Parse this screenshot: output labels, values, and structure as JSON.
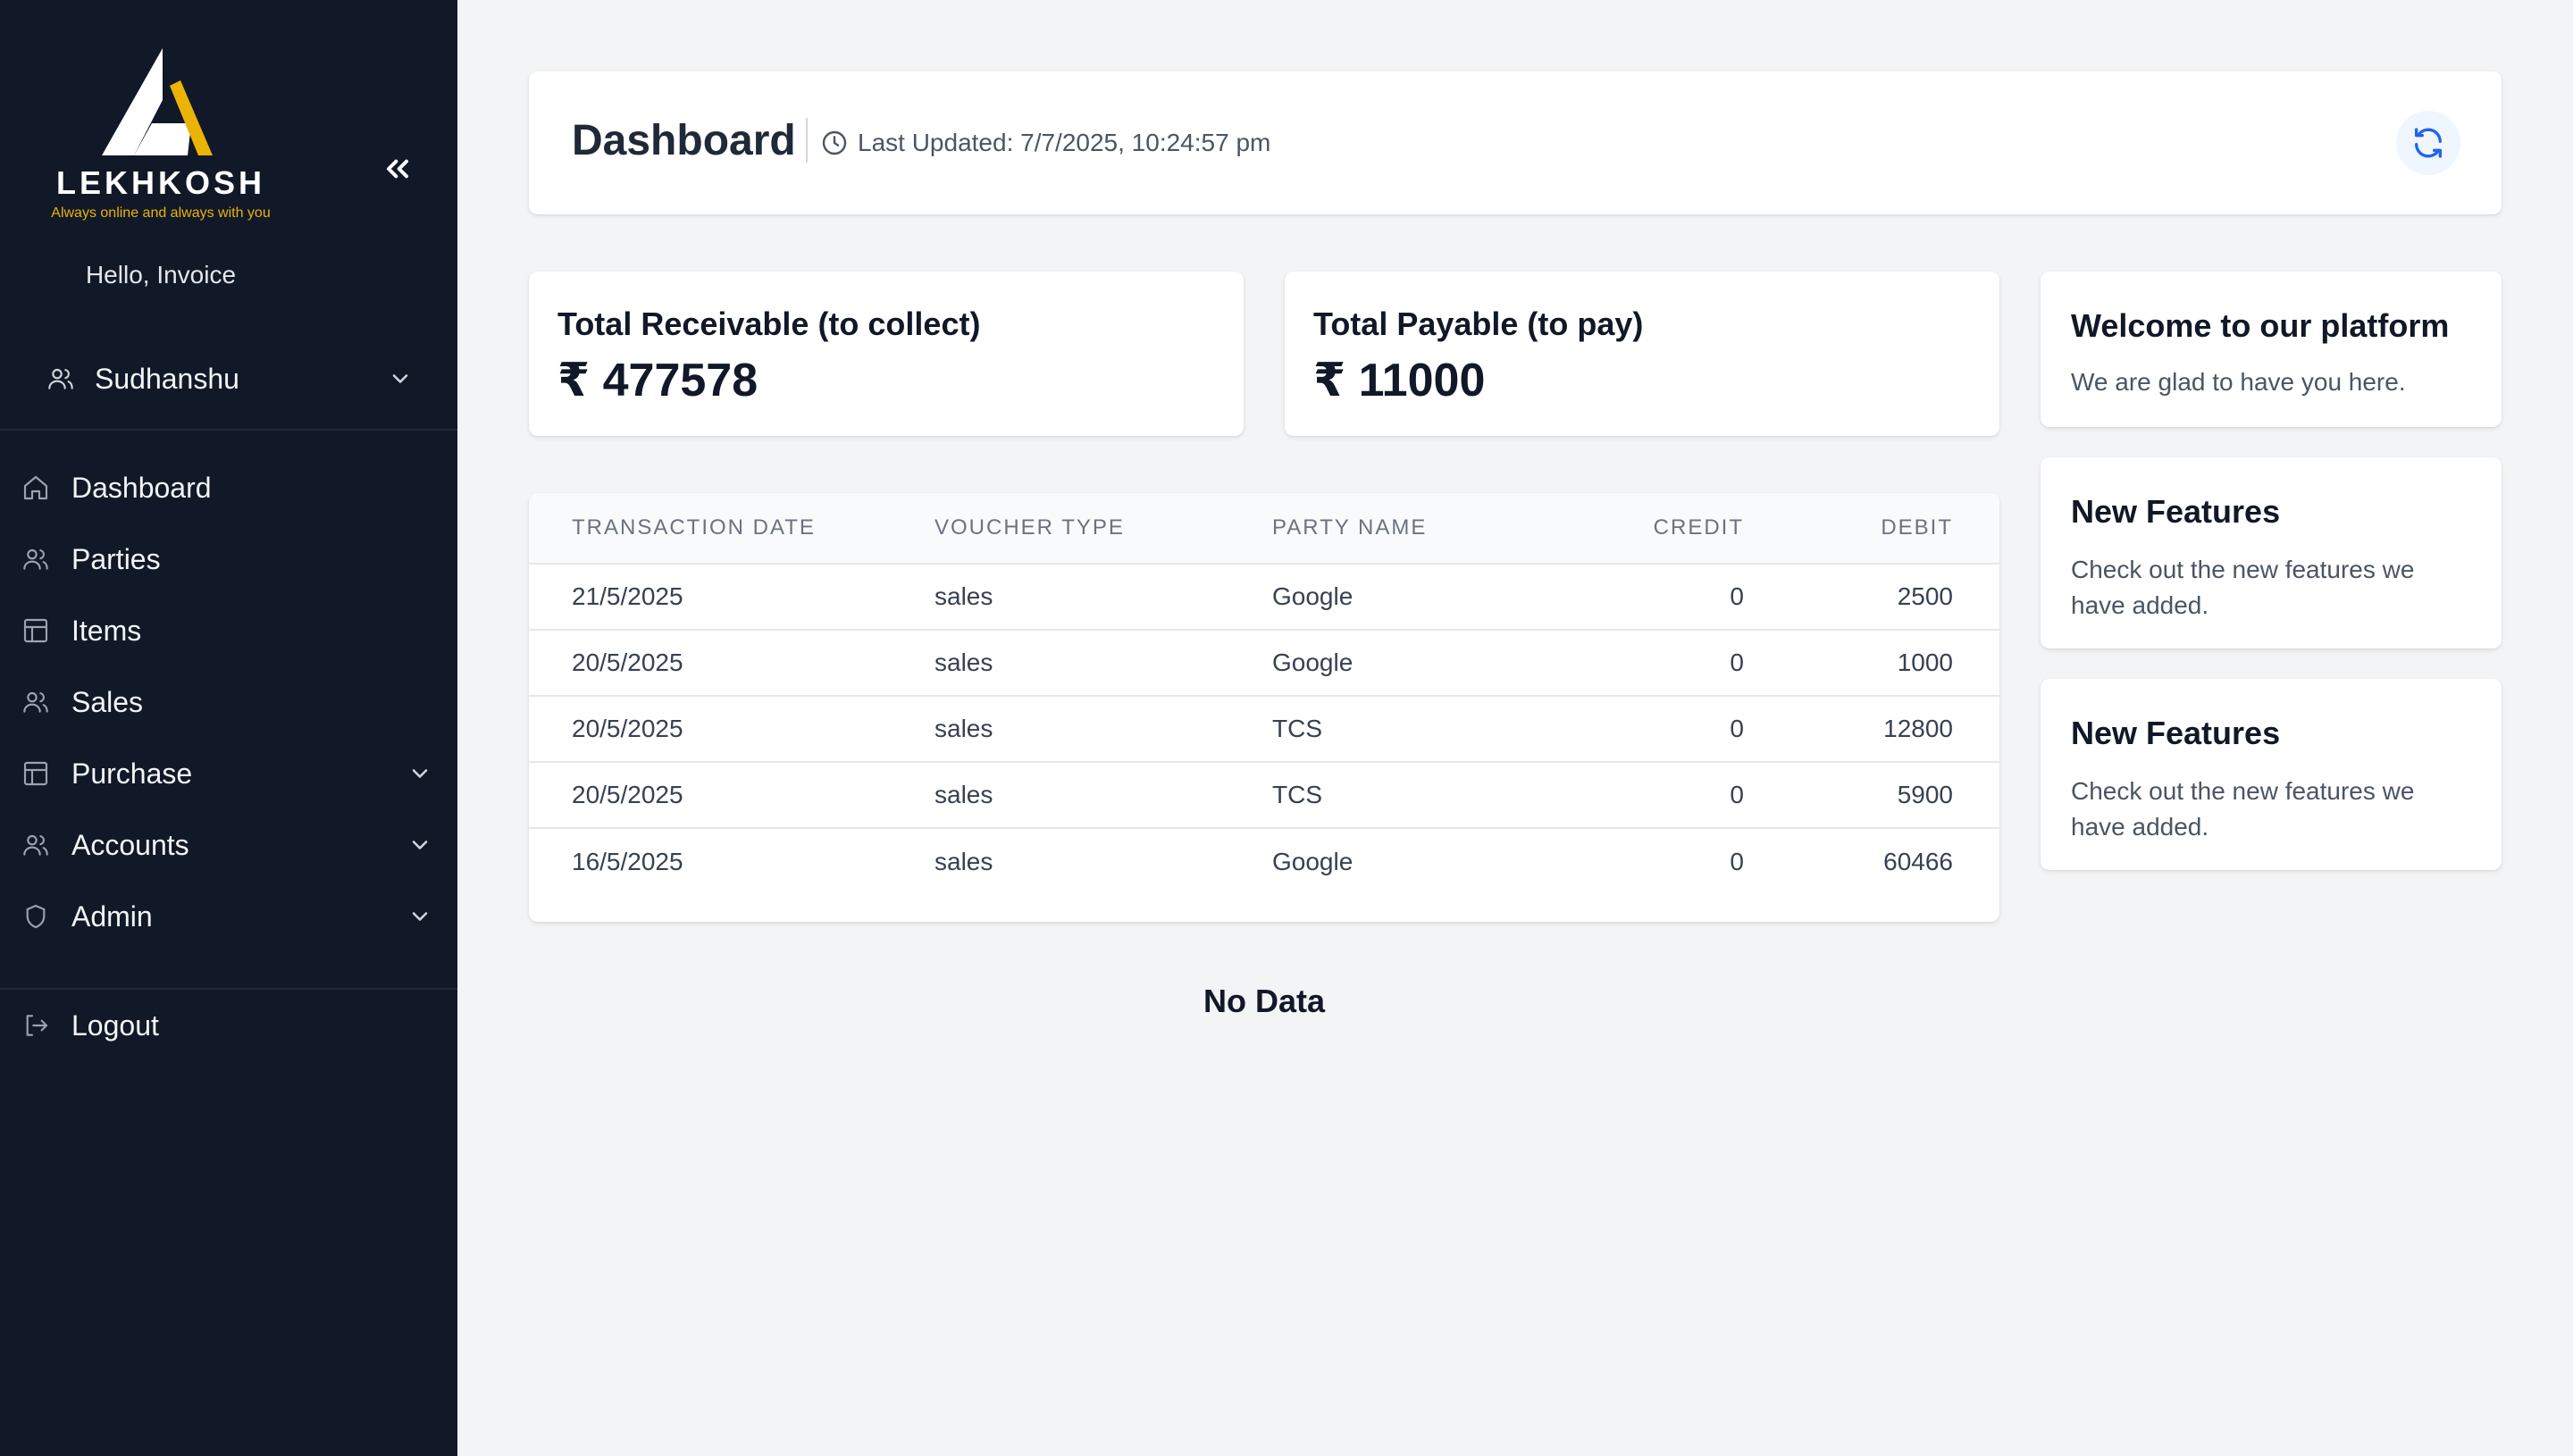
{
  "brand": {
    "name": "LEKHKOSH",
    "tagline": "Always online and always with you",
    "accent": "#eab308"
  },
  "sidebar": {
    "greeting": "Hello, Invoice",
    "user": "Sudhanshu",
    "items": [
      {
        "label": "Dashboard",
        "icon": "home-icon"
      },
      {
        "label": "Parties",
        "icon": "users-icon"
      },
      {
        "label": "Items",
        "icon": "table-icon"
      },
      {
        "label": "Sales",
        "icon": "users-icon"
      },
      {
        "label": "Purchase",
        "icon": "table-icon",
        "expandable": true
      },
      {
        "label": "Accounts",
        "icon": "users-icon",
        "expandable": true
      },
      {
        "label": "Admin",
        "icon": "shield-icon",
        "expandable": true
      }
    ],
    "logout": "Logout"
  },
  "header": {
    "title": "Dashboard",
    "last_updated": "Last Updated: 7/7/2025, 10:24:57 pm"
  },
  "stats": {
    "receivable_label": "Total Receivable (to collect)",
    "receivable_value": "₹ 477578",
    "payable_label": "Total Payable (to pay)",
    "payable_value": "₹ 11000"
  },
  "table": {
    "columns": [
      "Transaction Date",
      "Voucher Type",
      "Party Name",
      "Credit",
      "Debit"
    ],
    "rows": [
      [
        "21/5/2025",
        "sales",
        "Google",
        "0",
        "2500"
      ],
      [
        "20/5/2025",
        "sales",
        "Google",
        "0",
        "1000"
      ],
      [
        "20/5/2025",
        "sales",
        "TCS",
        "0",
        "12800"
      ],
      [
        "20/5/2025",
        "sales",
        "TCS",
        "0",
        "5900"
      ],
      [
        "16/5/2025",
        "sales",
        "Google",
        "0",
        "60466"
      ]
    ]
  },
  "no_data": "No Data",
  "side_cards": [
    {
      "title": "Welcome to our platform",
      "body": "We are glad to have you here."
    },
    {
      "title": "New Features",
      "body": "Check out the new features we have added."
    },
    {
      "title": "New Features",
      "body": "Check out the new features we have added."
    }
  ]
}
